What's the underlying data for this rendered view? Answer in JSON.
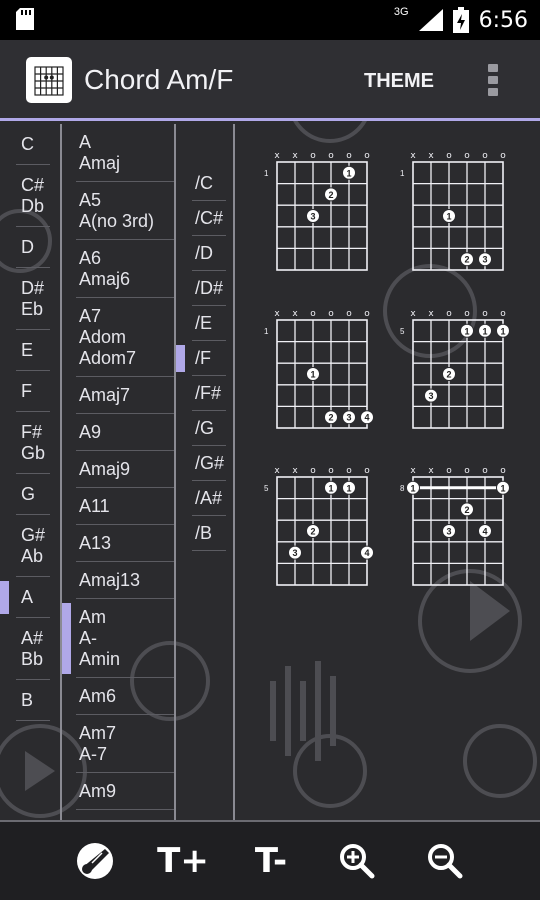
{
  "status_bar": {
    "time": "6:56",
    "network": "3G",
    "icons": [
      "sd-card-icon",
      "signal-icon",
      "battery-icon"
    ]
  },
  "header": {
    "title": "Chord Am/F",
    "theme_label": "THEME"
  },
  "root_notes": [
    {
      "lines": [
        "C"
      ],
      "selected": false
    },
    {
      "lines": [
        "C#",
        "Db"
      ],
      "selected": false
    },
    {
      "lines": [
        "D"
      ],
      "selected": false
    },
    {
      "lines": [
        "D#",
        "Eb"
      ],
      "selected": false
    },
    {
      "lines": [
        "E"
      ],
      "selected": false
    },
    {
      "lines": [
        "F"
      ],
      "selected": false
    },
    {
      "lines": [
        "F#",
        "Gb"
      ],
      "selected": false
    },
    {
      "lines": [
        "G"
      ],
      "selected": false
    },
    {
      "lines": [
        "G#",
        "Ab"
      ],
      "selected": false
    },
    {
      "lines": [
        "A"
      ],
      "selected": true
    },
    {
      "lines": [
        "A#",
        "Bb"
      ],
      "selected": false
    },
    {
      "lines": [
        "B"
      ],
      "selected": false
    }
  ],
  "chord_types": [
    {
      "lines": [
        "A",
        "Amaj"
      ],
      "selected": false
    },
    {
      "lines": [
        "A5",
        "A(no 3rd)"
      ],
      "selected": false
    },
    {
      "lines": [
        "A6",
        "Amaj6"
      ],
      "selected": false
    },
    {
      "lines": [
        "A7",
        "Adom",
        "Adom7"
      ],
      "selected": false
    },
    {
      "lines": [
        "Amaj7"
      ],
      "selected": false
    },
    {
      "lines": [
        "A9"
      ],
      "selected": false
    },
    {
      "lines": [
        "Amaj9"
      ],
      "selected": false
    },
    {
      "lines": [
        "A11"
      ],
      "selected": false
    },
    {
      "lines": [
        "A13"
      ],
      "selected": false
    },
    {
      "lines": [
        "Amaj13"
      ],
      "selected": false
    },
    {
      "lines": [
        "Am",
        "A-",
        "Amin"
      ],
      "selected": true
    },
    {
      "lines": [
        "Am6"
      ],
      "selected": false
    },
    {
      "lines": [
        "Am7",
        "A-7"
      ],
      "selected": false
    },
    {
      "lines": [
        "Am9"
      ],
      "selected": false
    }
  ],
  "bass_notes": [
    {
      "label": "/C",
      "selected": false
    },
    {
      "label": "/C#",
      "selected": false
    },
    {
      "label": "/D",
      "selected": false
    },
    {
      "label": "/D#",
      "selected": false
    },
    {
      "label": "/E",
      "selected": false
    },
    {
      "label": "/F",
      "selected": true
    },
    {
      "label": "/F#",
      "selected": false
    },
    {
      "label": "/G",
      "selected": false
    },
    {
      "label": "/G#",
      "selected": false
    },
    {
      "label": "/A#",
      "selected": false
    },
    {
      "label": "/B",
      "selected": false
    }
  ],
  "diagrams": [
    {
      "fret": "1",
      "strings": [
        "x",
        "x",
        "o",
        "o",
        "o",
        "o"
      ],
      "dots": [
        {
          "s": 5,
          "f": 1,
          "n": "1"
        },
        {
          "s": 4,
          "f": 2,
          "n": "2"
        },
        {
          "s": 3,
          "f": 3,
          "n": "3"
        }
      ],
      "barre": null
    },
    {
      "fret": "1",
      "strings": [
        "x",
        "x",
        "o",
        "o",
        "o",
        "o"
      ],
      "dots": [
        {
          "s": 3,
          "f": 3,
          "n": "1"
        },
        {
          "s": 4,
          "f": 5,
          "n": "2"
        },
        {
          "s": 5,
          "f": 5,
          "n": "3"
        }
      ],
      "barre": null
    },
    {
      "fret": "1",
      "strings": [
        "x",
        "x",
        "o",
        "o",
        "o",
        "o"
      ],
      "dots": [
        {
          "s": 3,
          "f": 3,
          "n": "1"
        },
        {
          "s": 4,
          "f": 5,
          "n": "2"
        },
        {
          "s": 5,
          "f": 5,
          "n": "3"
        },
        {
          "s": 6,
          "f": 5,
          "n": "4"
        }
      ],
      "barre": null
    },
    {
      "fret": "5",
      "strings": [
        "x",
        "x",
        "o",
        "o",
        "o",
        "o"
      ],
      "dots": [
        {
          "s": 4,
          "f": 1,
          "n": "1"
        },
        {
          "s": 5,
          "f": 1,
          "n": "1"
        },
        {
          "s": 6,
          "f": 1,
          "n": "1"
        },
        {
          "s": 3,
          "f": 3,
          "n": "2"
        },
        {
          "s": 2,
          "f": 4,
          "n": "3"
        }
      ],
      "barre": null
    },
    {
      "fret": "5",
      "strings": [
        "x",
        "x",
        "o",
        "o",
        "o",
        "o"
      ],
      "dots": [
        {
          "s": 4,
          "f": 1,
          "n": "1"
        },
        {
          "s": 5,
          "f": 1,
          "n": "1"
        },
        {
          "s": 3,
          "f": 3,
          "n": "2"
        },
        {
          "s": 2,
          "f": 4,
          "n": "3"
        },
        {
          "s": 6,
          "f": 4,
          "n": "4"
        }
      ],
      "barre": null
    },
    {
      "fret": "8",
      "strings": [
        "x",
        "x",
        "o",
        "o",
        "o",
        "o"
      ],
      "dots": [
        {
          "s": 1,
          "f": 1,
          "n": "1"
        },
        {
          "s": 6,
          "f": 1,
          "n": "1"
        },
        {
          "s": 4,
          "f": 2,
          "n": "2"
        },
        {
          "s": 3,
          "f": 3,
          "n": "3"
        },
        {
          "s": 5,
          "f": 3,
          "n": "4"
        }
      ],
      "barre": {
        "from": 1,
        "to": 6,
        "f": 1
      }
    }
  ],
  "bottom_bar": {
    "text_plus": "T+",
    "text_minus": "T-",
    "icons": [
      "guitar-pick-icon",
      "zoom-in-icon",
      "zoom-out-icon"
    ]
  },
  "colors": {
    "accent": "#b0a8e8",
    "background": "#2b2b2e",
    "appbar": "#2f2f33",
    "bottombar": "#1f1f22"
  }
}
